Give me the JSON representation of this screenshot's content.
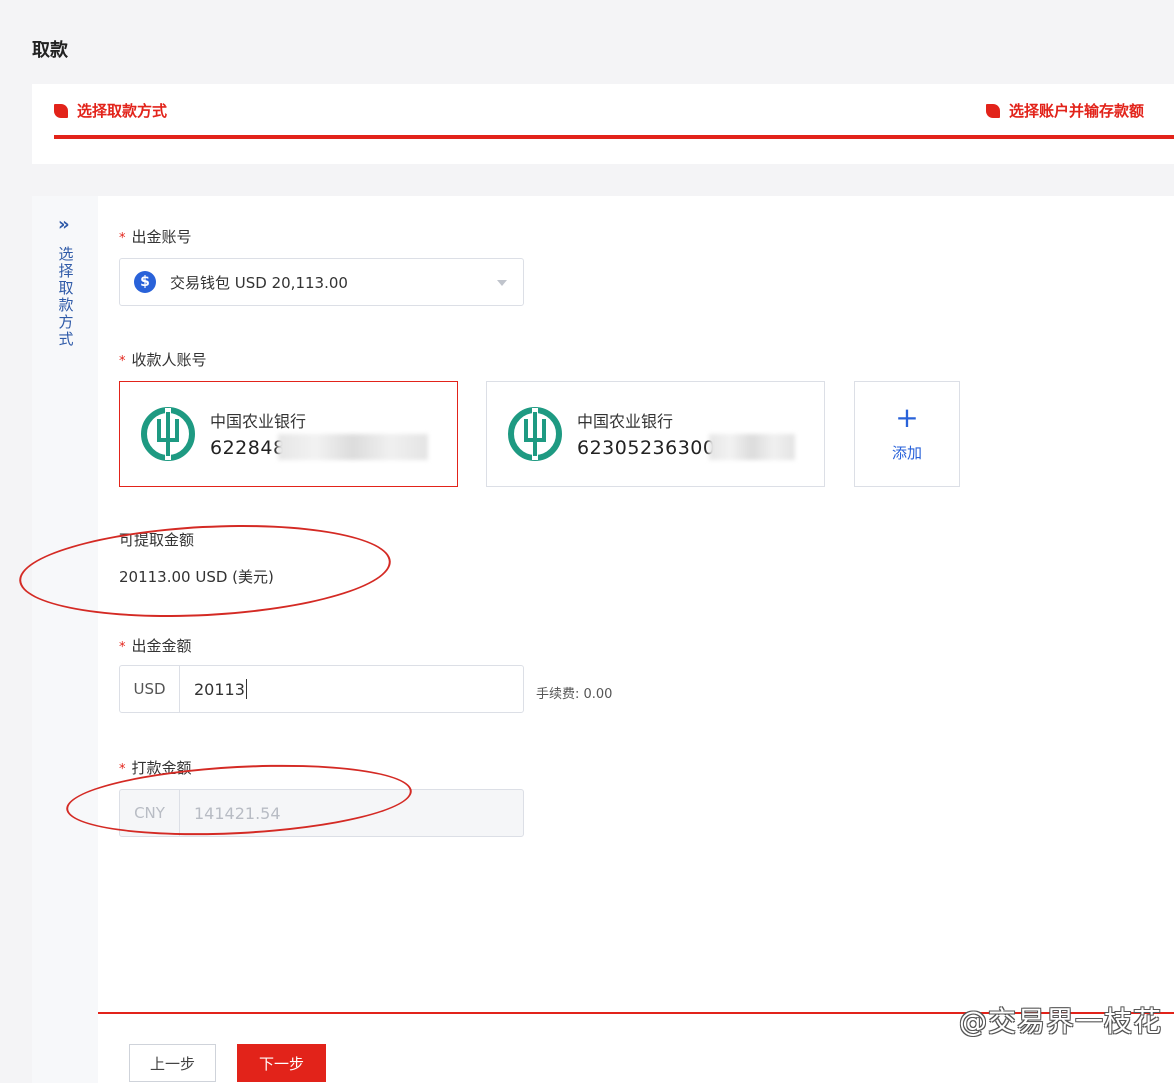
{
  "page": {
    "title": "取款"
  },
  "steps": [
    {
      "label": "选择取款方式",
      "active": true
    },
    {
      "label": "选择账户并输存款额",
      "active": true
    }
  ],
  "sidebar": {
    "label_chars": [
      "选",
      "择",
      "取",
      "款",
      "方",
      "式"
    ]
  },
  "withdraw_account": {
    "label": "出金账号",
    "required_mark": "*",
    "selected": "交易钱包 USD 20,113.00",
    "icon": "dollar-icon"
  },
  "payee_account": {
    "label": "收款人账号",
    "required_mark": "*",
    "cards": [
      {
        "bank": "中国农业银行",
        "number_visible": "622848",
        "selected": true
      },
      {
        "bank": "中国农业银行",
        "number_visible": "623052363000",
        "selected": false
      }
    ],
    "add_label": "添加"
  },
  "available": {
    "label": "可提取金额",
    "value": "20113.00 USD (美元)"
  },
  "withdraw_amount": {
    "label": "出金金额",
    "required_mark": "*",
    "currency": "USD",
    "value": "20113",
    "fee": "手续费: 0.00"
  },
  "payout_amount": {
    "label": "打款金额",
    "required_mark": "*",
    "currency": "CNY",
    "value": "141421.54"
  },
  "buttons": {
    "prev": "上一步",
    "next": "下一步"
  },
  "watermark": "@交易界一枝花",
  "colors": {
    "accent": "#e2231a",
    "link": "#2962d9",
    "bank_green": "#1e9a82"
  }
}
